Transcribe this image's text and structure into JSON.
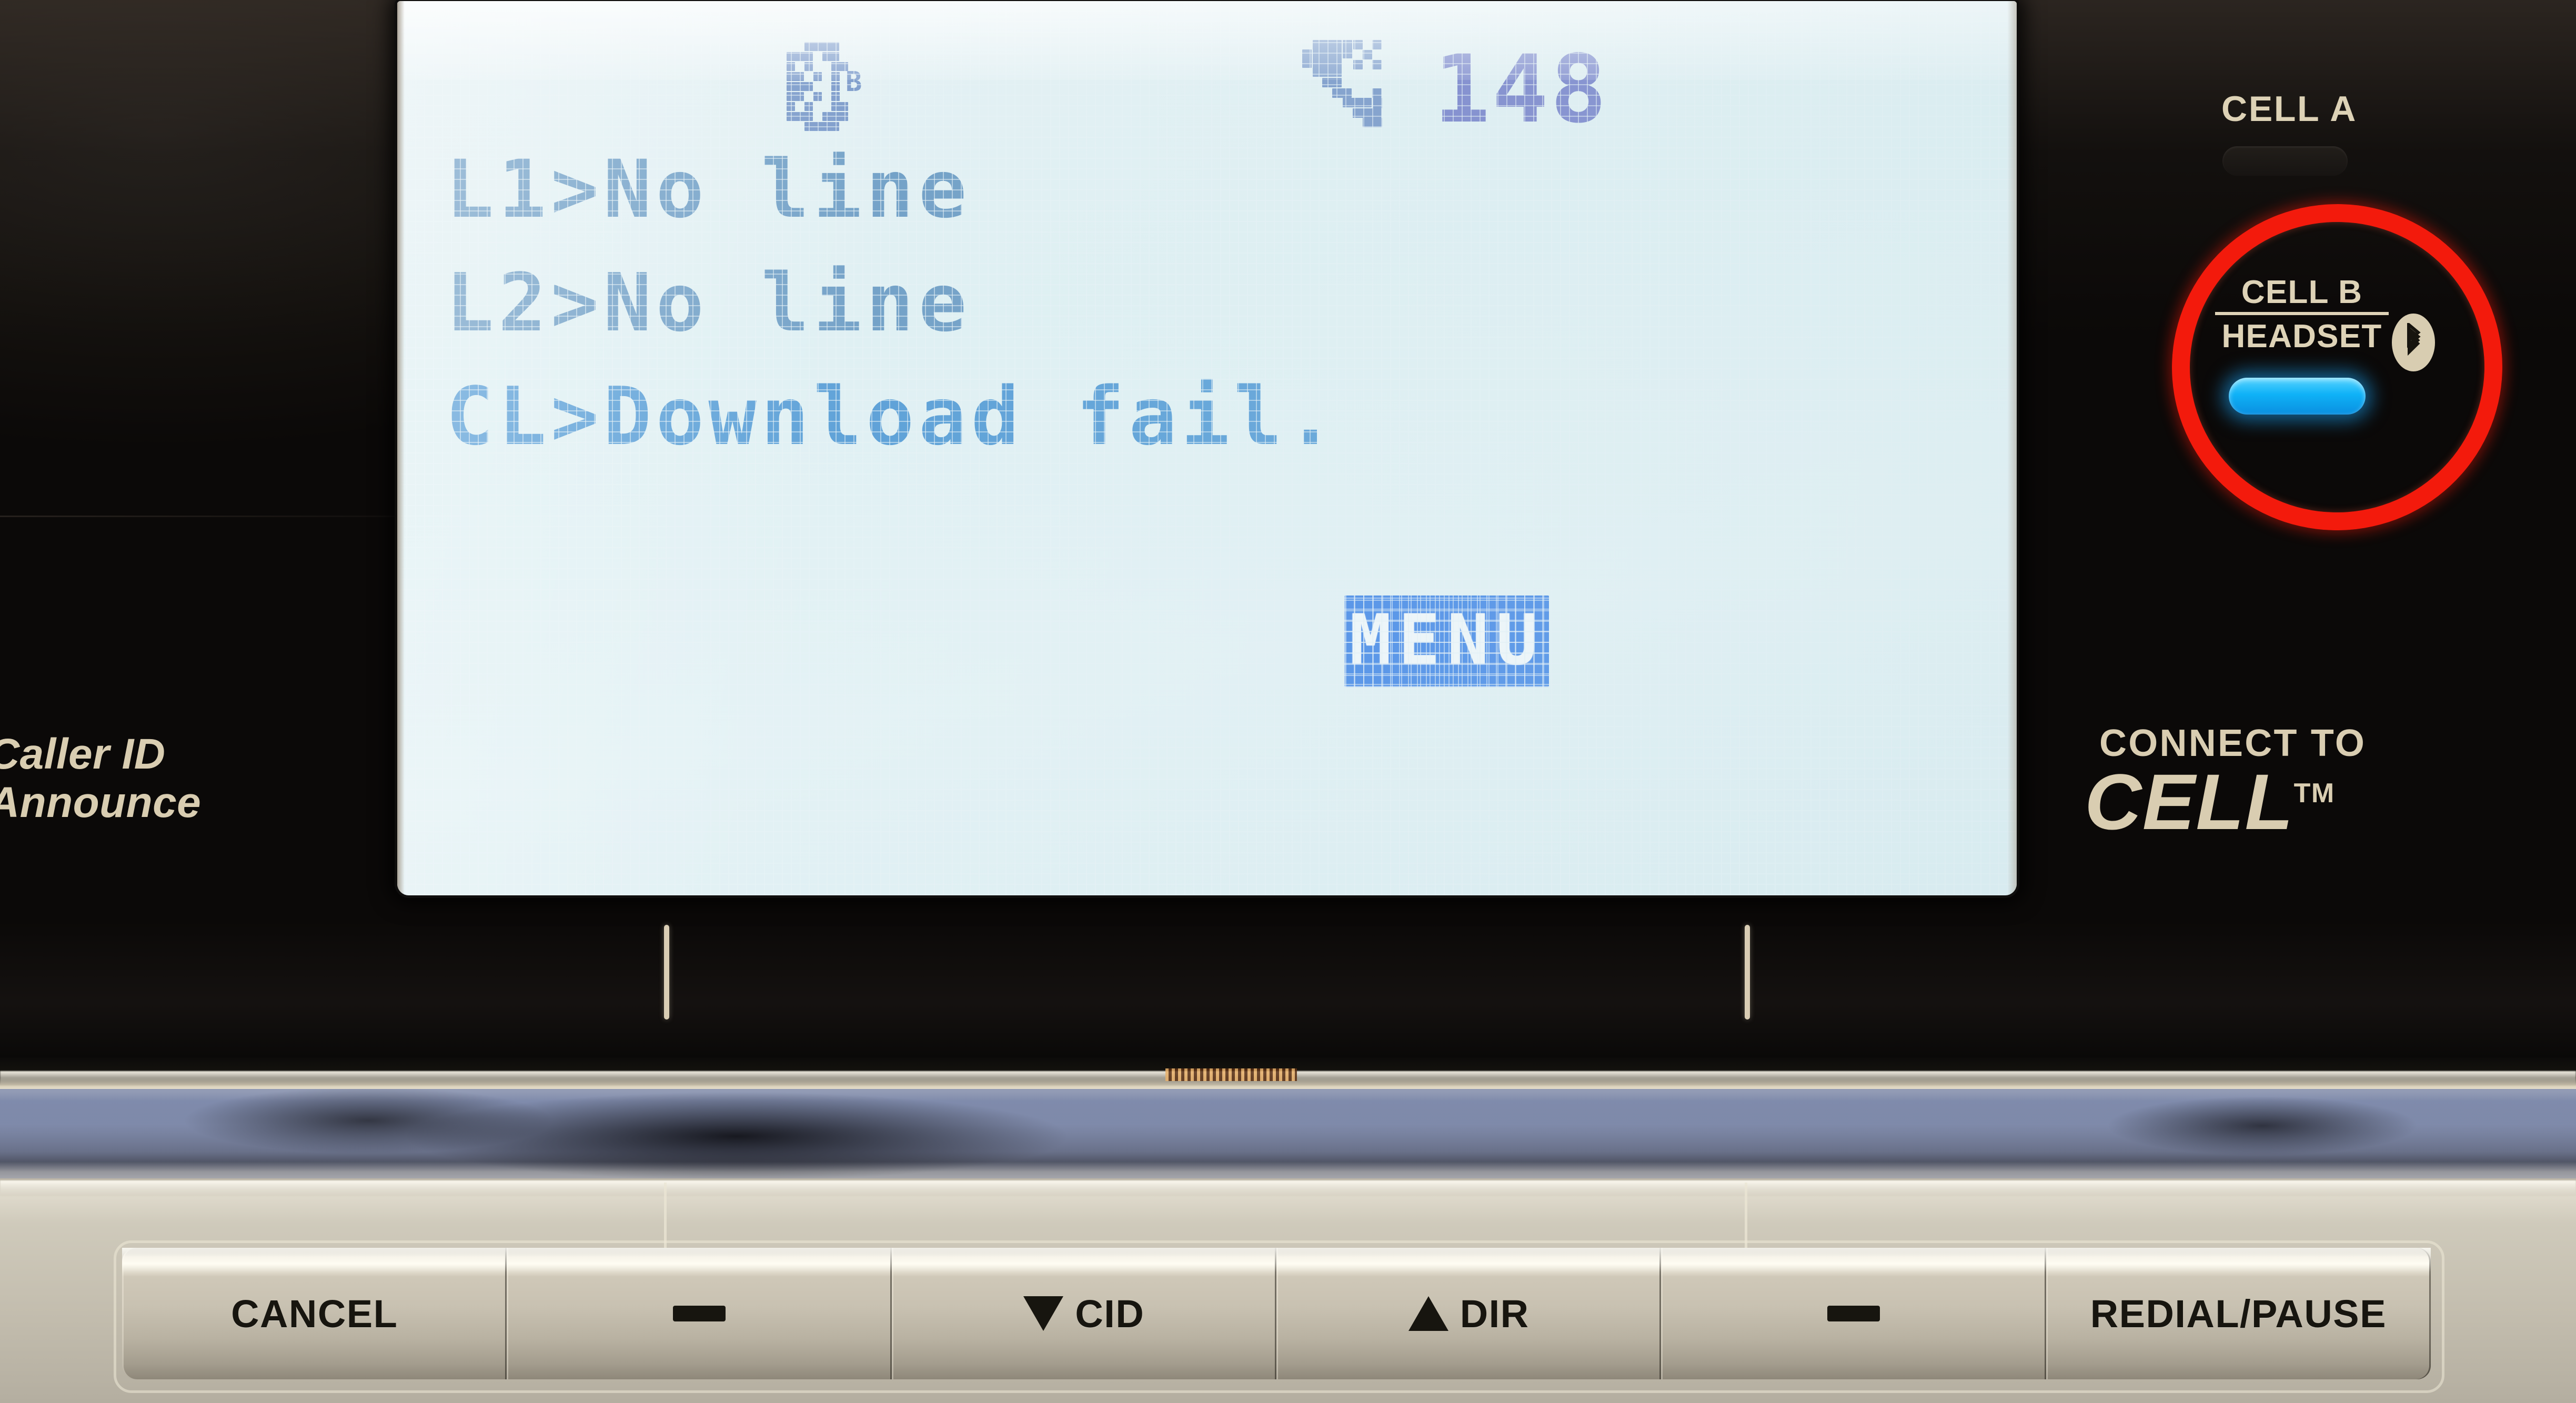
{
  "device": {
    "left_panel_label": "Caller ID\nAnnounce",
    "brand_line1": "CONNECT TO",
    "brand_line2": "CELL",
    "brand_tm": "TM"
  },
  "indicators": {
    "cell_a": {
      "label": "CELL A",
      "led_state": "off",
      "led_color": "#1b1815"
    },
    "cell_b": {
      "label_line1": "CELL B",
      "label_line2": "HEADSET",
      "bluetooth_badge": "bluetooth-icon",
      "led_state": "on",
      "led_color": "#19b4f7",
      "annotation_circle_color": "#f31a0c"
    }
  },
  "lcd": {
    "background_color": "#e1f0f4",
    "pixel_color": "#74a2c8",
    "status_bar": {
      "bluetooth_icon": "bluetooth-icon",
      "bluetooth_suffix": "B",
      "missed_call_icon": "handset-missed-call-icon",
      "missed_call_count": "148"
    },
    "lines": [
      "L1>No line",
      "L2>No line",
      "CL>Download fail."
    ],
    "softkey": {
      "label": "MENU",
      "highlighted": true,
      "highlight_color": "#4a8ce8"
    }
  },
  "buttons": [
    {
      "label": "CANCEL",
      "icon": "none"
    },
    {
      "label": "",
      "icon": "dash-icon"
    },
    {
      "label": "CID",
      "icon": "triangle-down-icon"
    },
    {
      "label": "DIR",
      "icon": "triangle-up-icon"
    },
    {
      "label": "",
      "icon": "dash-icon"
    },
    {
      "label": "REDIAL/PAUSE",
      "icon": "none"
    }
  ]
}
